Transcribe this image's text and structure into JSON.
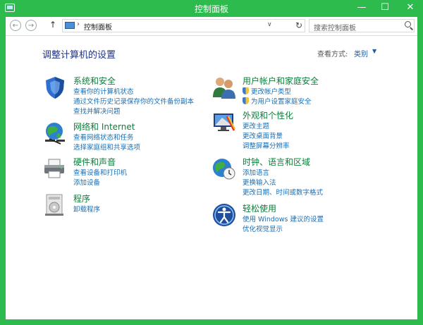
{
  "window": {
    "title": "控制面板",
    "min_glyph": "—",
    "max_glyph": "☐",
    "close_glyph": "✕"
  },
  "addressbar": {
    "back_glyph": "←",
    "forward_glyph": "→",
    "up_glyph": "↑",
    "separator": "›",
    "path": "控制面板",
    "dropdown_glyph": "∨",
    "refresh_glyph": "↻",
    "search_placeholder": "搜索控制面板"
  },
  "main": {
    "heading": "调整计算机的设置",
    "view_by_label": "查看方式:",
    "view_by_value": "类别",
    "view_by_arrow": "▼",
    "left_groups": [
      {
        "title": "系统和安全",
        "icon": "shield-icon",
        "links": [
          "查看你的计算机状态",
          "通过文件历史记录保存你的文件备份副本",
          "查找并解决问题"
        ]
      },
      {
        "title": "网络和 Internet",
        "icon": "network-globe-icon",
        "links": [
          "查看网络状态和任务",
          "选择家庭组和共享选项"
        ]
      },
      {
        "title": "硬件和声音",
        "icon": "printer-icon",
        "links": [
          "查看设备和打印机",
          "添加设备"
        ]
      },
      {
        "title": "程序",
        "icon": "programs-icon",
        "links": [
          "卸载程序"
        ]
      }
    ],
    "right_groups": [
      {
        "title": "用户帐户和家庭安全",
        "icon": "users-icon",
        "links": [
          "更改帐户类型",
          "为用户设置家庭安全"
        ],
        "shielded": [
          true,
          true
        ]
      },
      {
        "title": "外观和个性化",
        "icon": "monitor-paint-icon",
        "links": [
          "更改主题",
          "更改桌面背景",
          "调整屏幕分辨率"
        ]
      },
      {
        "title": "时钟、语言和区域",
        "icon": "clock-globe-icon",
        "links": [
          "添加语言",
          "更换输入法",
          "更改日期、时间或数字格式"
        ]
      },
      {
        "title": "轻松使用",
        "icon": "ease-of-access-icon",
        "links": [
          "使用 Windows 建议的设置",
          "优化视觉显示"
        ]
      }
    ]
  },
  "colors": {
    "frame": "#2dbb4e",
    "heading": "#1e3287",
    "group_title": "#0d7d3b",
    "link": "#1a6fb5"
  }
}
